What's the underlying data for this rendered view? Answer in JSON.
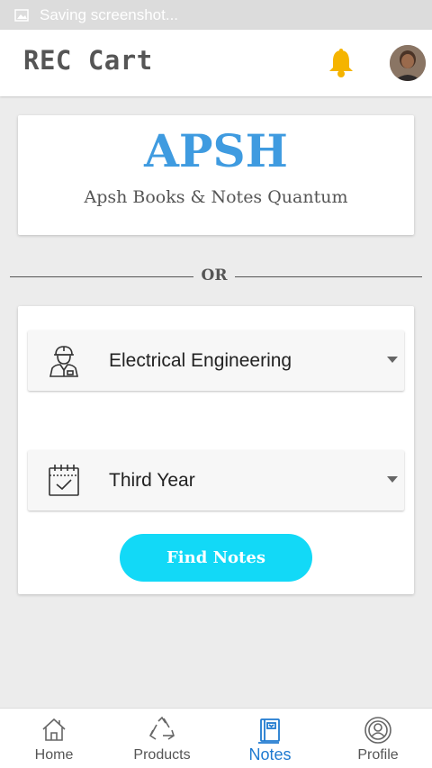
{
  "status_bar": {
    "text": "Saving screenshot..."
  },
  "header": {
    "title": "REC Cart"
  },
  "brand": {
    "title": "APSH",
    "subtitle": "Apsh Books & Notes Quantum"
  },
  "divider": {
    "text": "OR"
  },
  "form": {
    "branch": {
      "selected": "Electrical Engineering",
      "icon": "engineer-icon"
    },
    "year": {
      "selected": "Third Year",
      "icon": "calendar-icon"
    },
    "submit_label": "Find Notes"
  },
  "bottom_nav": {
    "items": [
      {
        "label": "Home",
        "icon": "home-icon"
      },
      {
        "label": "Products",
        "icon": "recycle-icon"
      },
      {
        "label": "Notes",
        "icon": "notes-icon",
        "active": true
      },
      {
        "label": "Profile",
        "icon": "profile-icon"
      }
    ]
  },
  "colors": {
    "accent": "#3f9be0",
    "button": "#12d9f7",
    "active_nav": "#1f7ad0",
    "bell": "#f5b400"
  }
}
